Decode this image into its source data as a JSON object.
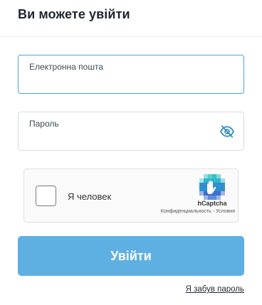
{
  "header": {
    "title": "Ви можете увійти"
  },
  "form": {
    "email": {
      "label": "Електронна пошта",
      "value": ""
    },
    "password": {
      "label": "Пароль",
      "value": "",
      "toggle_icon": "eye-slash-icon"
    },
    "submit_label": "Увійти",
    "forgot_label": "Я забув пароль"
  },
  "captcha": {
    "checkbox_label": "Я человек",
    "brand": "hCaptcha",
    "privacy": "Конфиденциальность",
    "separator": " - ",
    "terms": "Условия",
    "logo_icon": "hcaptcha-logo-icon"
  },
  "colors": {
    "accent": "#5fb0e2",
    "focus_border": "#4aa3d8",
    "eye_icon": "#2f8fbf"
  }
}
